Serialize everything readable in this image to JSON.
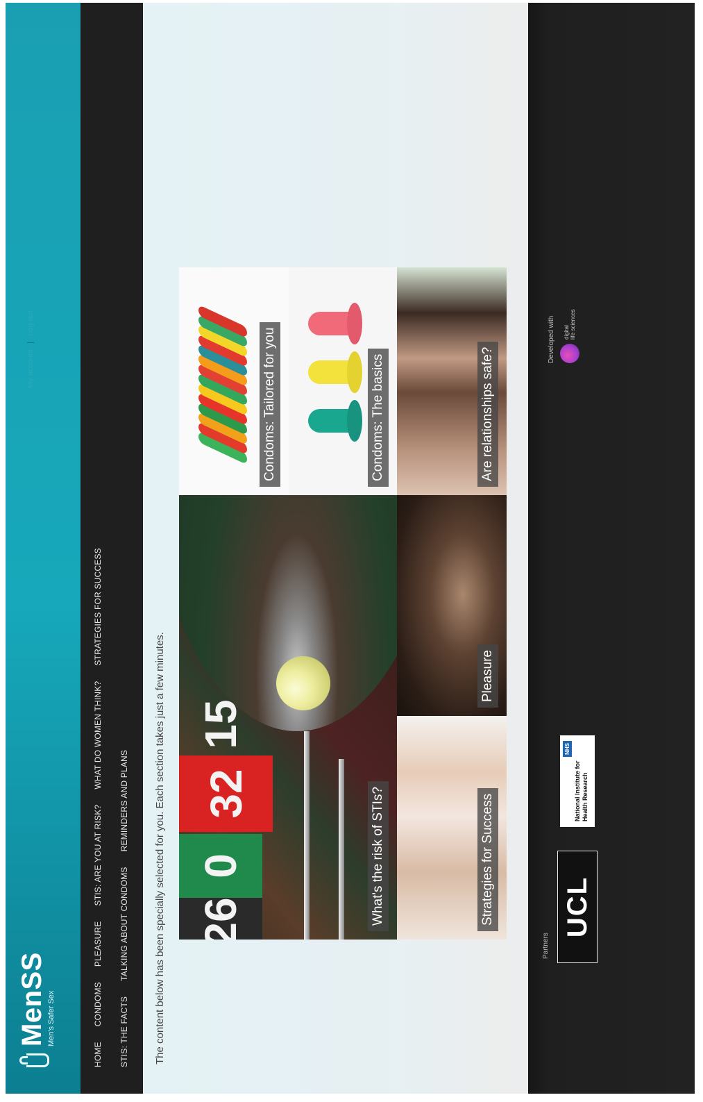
{
  "header": {
    "logo_title": "MenSS",
    "logo_subtitle": "Men's Safer Sex",
    "account_links": [
      "My account",
      "Log out"
    ]
  },
  "nav": {
    "row1": [
      "HOME",
      "CONDOMS",
      "PLEASURE",
      "STIS: ARE YOU AT RISK?",
      "WHAT DO WOMEN THINK?",
      "STRATEGIES FOR SUCCESS"
    ],
    "row2": [
      "STIS: THE FACTS",
      "TALKING ABOUT CONDOMS",
      "REMINDERS AND PLANS"
    ]
  },
  "content": {
    "intro": "The content below has been specially selected for you. Each section takes just a few minutes.",
    "tiles": {
      "risk": "What's the risk of STIs?",
      "tailored": "Condoms: Tailored for you",
      "basics": "Condoms: The basics",
      "strategies": "Strategies for Success",
      "pleasure": "Pleasure",
      "relationships": "Are relationships safe?"
    },
    "roulette_numbers": [
      "26",
      "0",
      "32",
      "15"
    ]
  },
  "footer": {
    "partners_label": "Partners",
    "ucl": "UCL",
    "nihr_badge": "NHS",
    "nihr_text": "National Institute for Health Research",
    "developed_with": "Developed with",
    "dls_line1": "digital",
    "dls_line2": "life sciences"
  }
}
